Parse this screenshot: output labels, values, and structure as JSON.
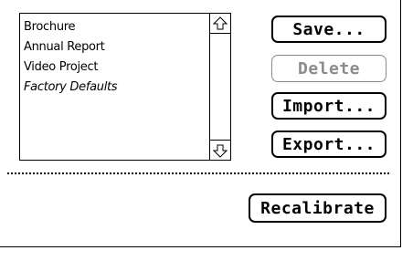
{
  "presets": {
    "items": [
      {
        "label": "Brochure",
        "italic": false
      },
      {
        "label": "Annual Report",
        "italic": false
      },
      {
        "label": "Video Project",
        "italic": false
      },
      {
        "label": "Factory Defaults",
        "italic": true
      }
    ],
    "scroll_up_icon": "scroll-up-arrow",
    "scroll_down_icon": "scroll-down-arrow"
  },
  "buttons": {
    "save": "Save...",
    "delete": "Delete",
    "import": "Import...",
    "export": "Export...",
    "recalibrate": "Recalibrate"
  },
  "states": {
    "delete_enabled": false
  },
  "colors": {
    "disabled_text": "#8c8c8c",
    "foreground": "#000000",
    "background": "#ffffff"
  }
}
